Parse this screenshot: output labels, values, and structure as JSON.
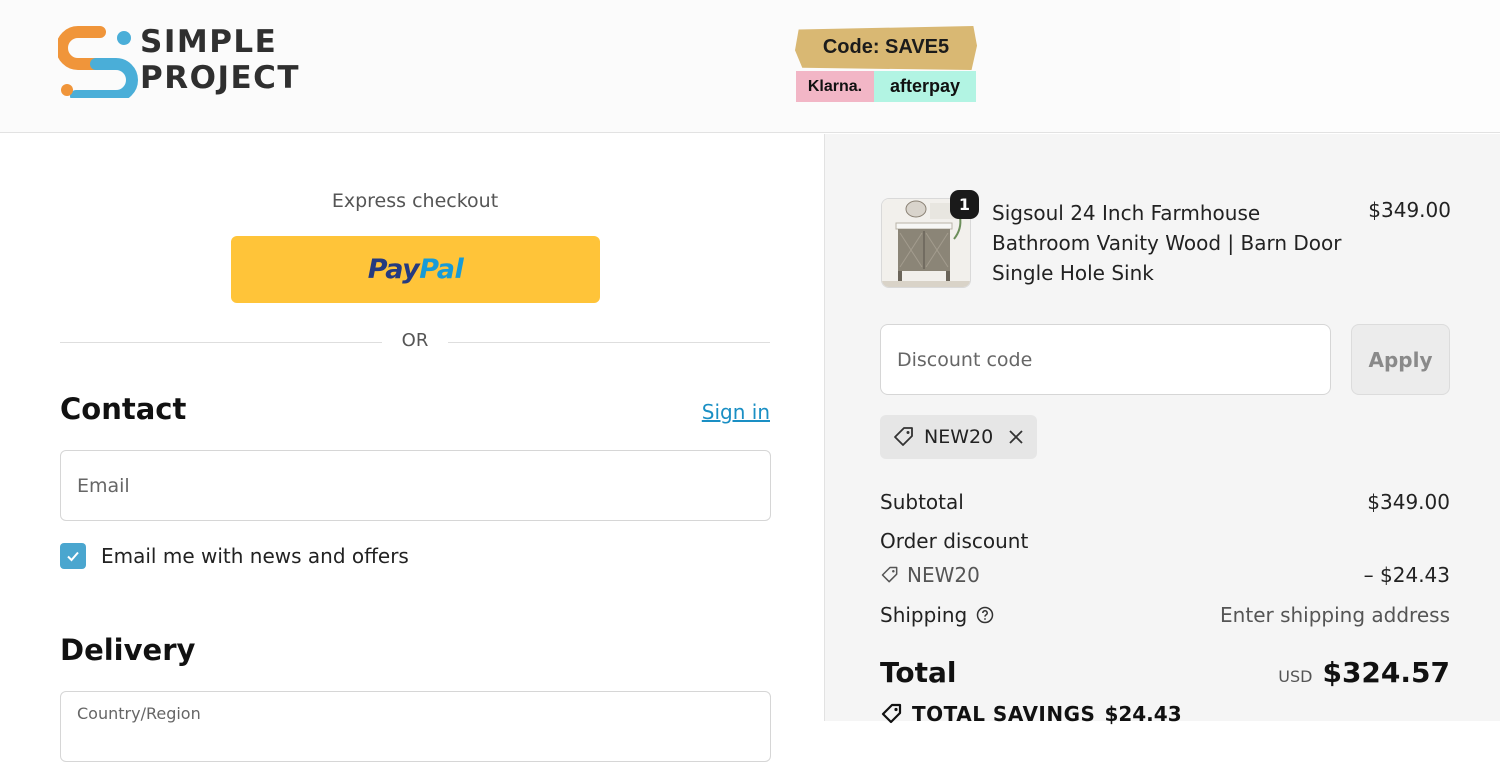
{
  "header": {
    "logo_line1": "SIMPLE",
    "logo_line2": "PROJECT",
    "promo_code": "Code: SAVE5",
    "promo_klarna": "Klarna.",
    "promo_afterpay": "afterpay"
  },
  "express": {
    "label": "Express checkout",
    "paypal_part1": "Pay",
    "paypal_part2": "Pal",
    "or_label": "OR"
  },
  "contact": {
    "title": "Contact",
    "signin_label": "Sign in",
    "email_placeholder": "Email",
    "newsletter_label": "Email me with news and offers",
    "newsletter_checked": true
  },
  "delivery": {
    "title": "Delivery",
    "country_label": "Country/Region"
  },
  "order": {
    "item_title": "Sigsoul 24 Inch Farmhouse Bathroom Vanity Wood | Barn Door Single Hole Sink",
    "item_price": "$349.00",
    "item_qty": "1",
    "discount_placeholder": "Discount code",
    "apply_label": "Apply",
    "applied_code": "NEW20",
    "subtotal_label": "Subtotal",
    "subtotal_value": "$349.00",
    "order_discount_label": "Order discount",
    "discount_code_label": "NEW20",
    "discount_value": "– $24.43",
    "shipping_label": "Shipping",
    "shipping_value": "Enter shipping address",
    "total_label": "Total",
    "currency": "USD",
    "total_value": "$324.57",
    "savings_label": "TOTAL SAVINGS",
    "savings_value": "$24.43"
  },
  "colors": {
    "paypal_yellow": "#ffc439",
    "link_blue": "#1a8fc4",
    "checkbox_blue": "#4aa6cf",
    "logo_orange": "#f0953a",
    "logo_blue": "#4aaed8"
  }
}
